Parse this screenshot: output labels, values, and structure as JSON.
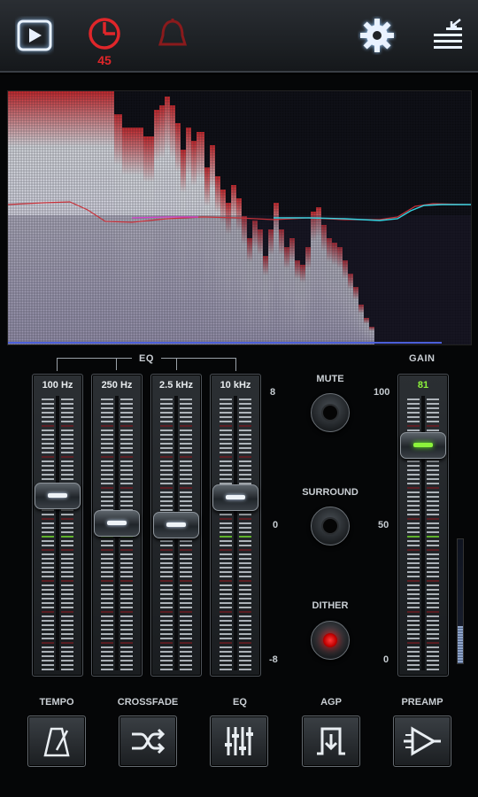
{
  "toolbar": {
    "timer_value": "45",
    "icons": [
      "play-icon",
      "timer-icon",
      "alarm-icon",
      "gear-icon",
      "menu-icon"
    ]
  },
  "eq": {
    "title": "EQ",
    "bands": [
      {
        "label": "100 Hz",
        "level": 1.8
      },
      {
        "label": "250 Hz",
        "level": 0.1
      },
      {
        "label": "2.5 kHz",
        "level": 0.0
      },
      {
        "label": "10 kHz",
        "level": 1.7
      }
    ],
    "scale_top": "8",
    "scale_mid": "0",
    "scale_bottom": "-8"
  },
  "switches": {
    "mute_label": "MUTE",
    "surround_label": "SURROUND",
    "dither_label": "DITHER"
  },
  "gain": {
    "title": "GAIN",
    "value": "81",
    "scale_top": "100",
    "scale_mid": "50",
    "scale_bottom": "0",
    "meter_level": 0.3
  },
  "bottom": {
    "tempo_label": "TEMPO",
    "crossfade_label": "CROSSFADE",
    "eq_label": "EQ",
    "agp_label": "AGP",
    "preamp_label": "PREAMP"
  },
  "colors": {
    "accent_red": "#e0262a",
    "gain_green": "#8cf33b",
    "eq_curve_cyan": "#34d3e0"
  }
}
